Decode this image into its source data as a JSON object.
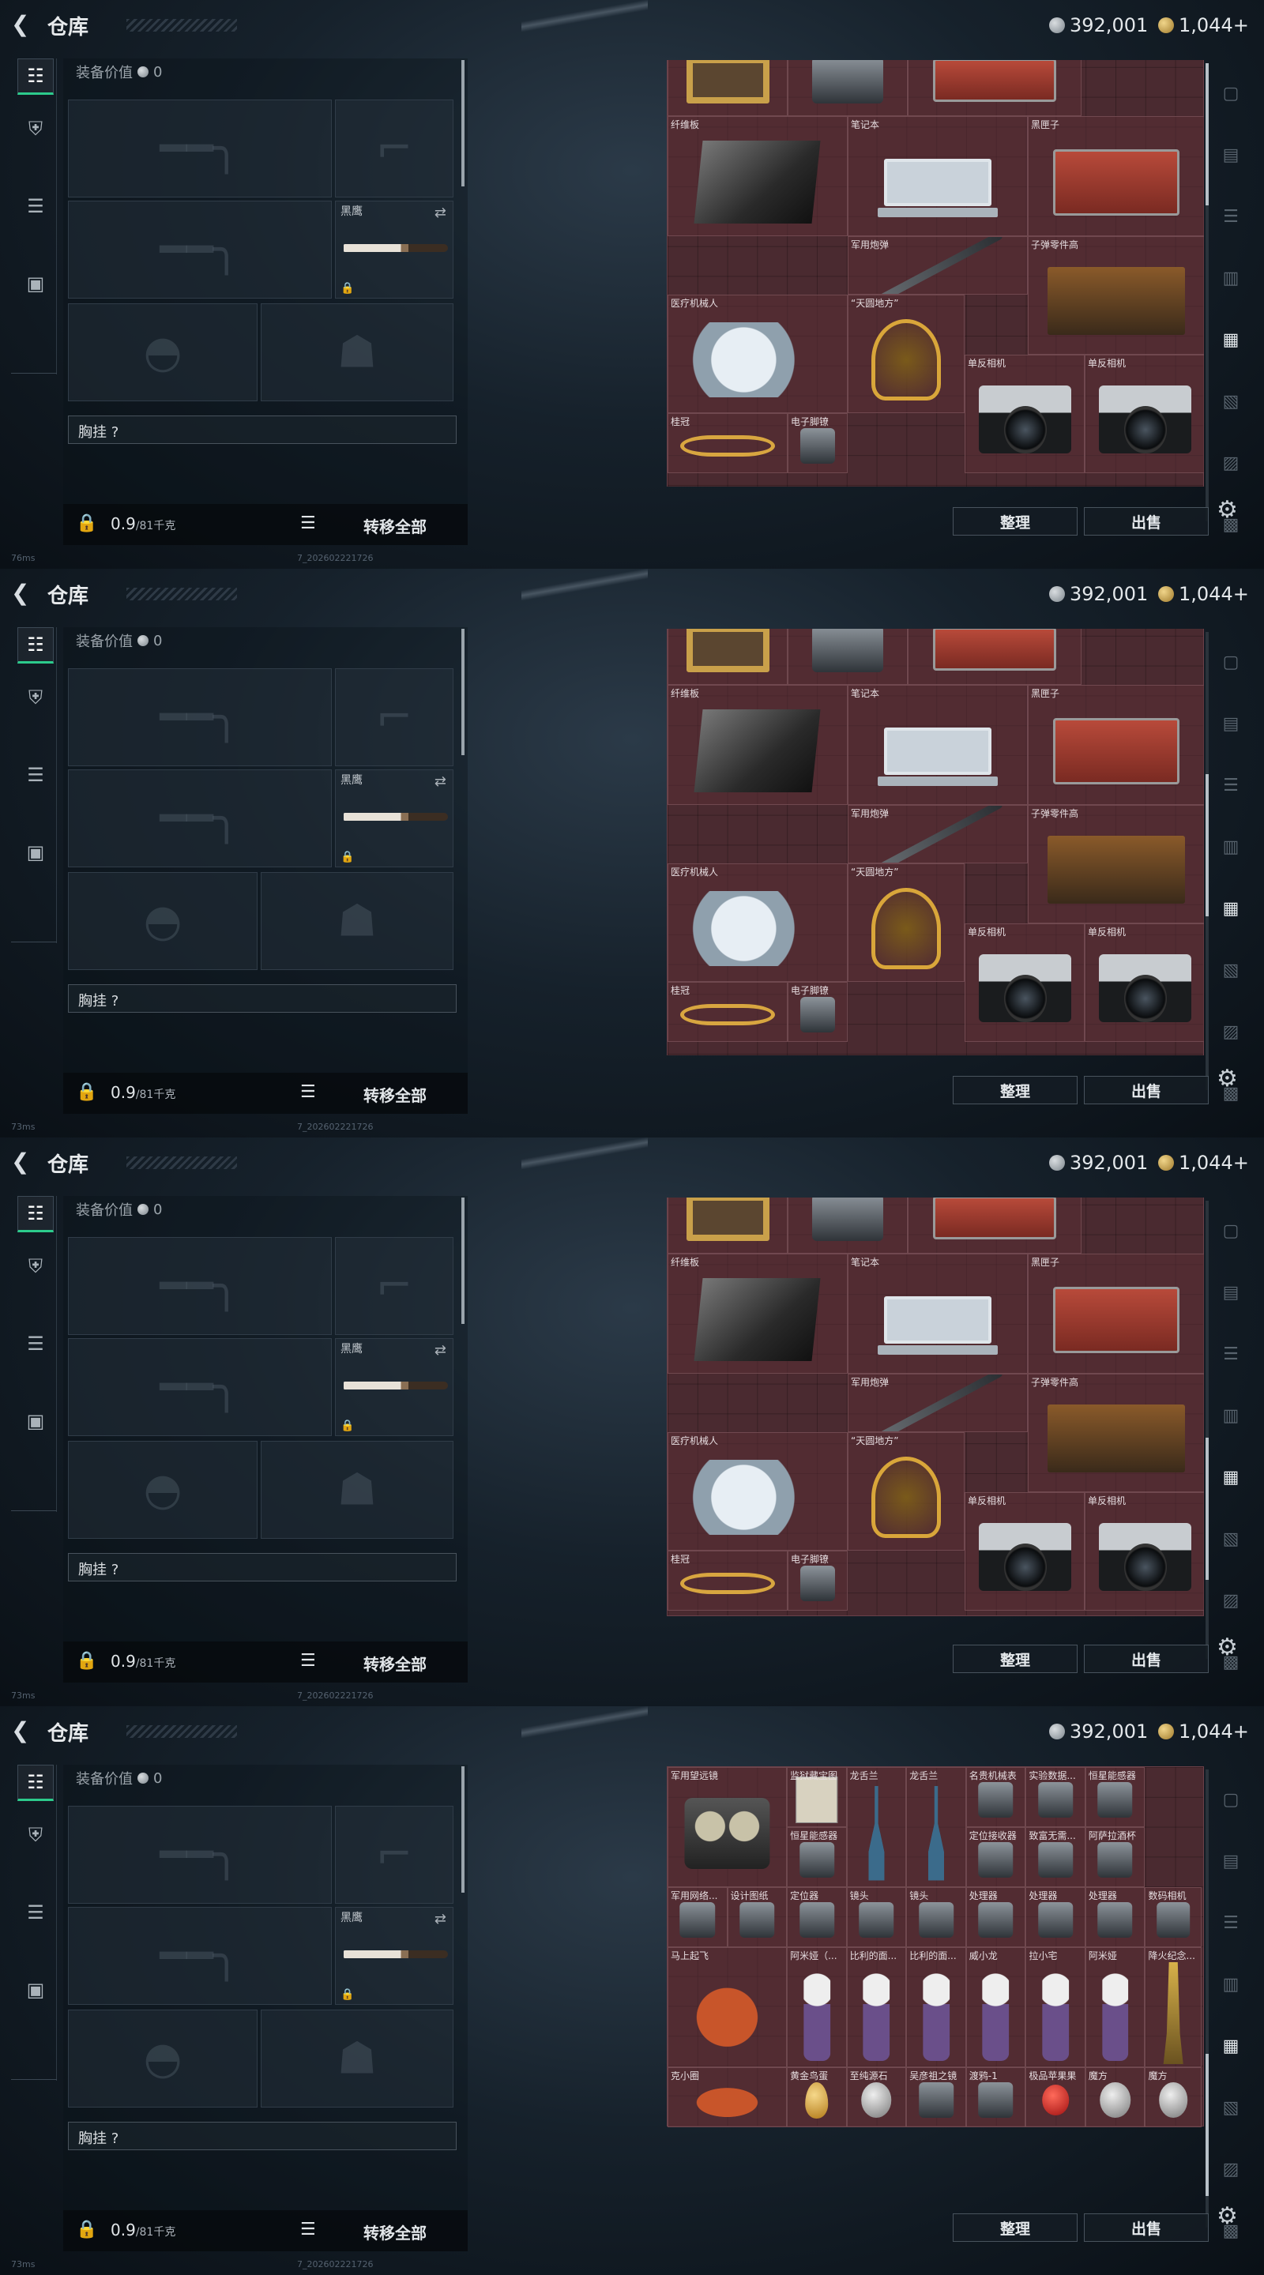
{
  "header": {
    "back_icon": "chevron-left-icon",
    "title": "仓库",
    "silver_amount": "392,001",
    "gold_amount": "1,044+"
  },
  "left_nav": {
    "items": [
      {
        "icon": "pistol-icon",
        "active": true
      },
      {
        "icon": "armor-icon",
        "active": false
      },
      {
        "icon": "clipboard-icon",
        "active": false
      },
      {
        "icon": "briefcase-icon",
        "active": false
      }
    ]
  },
  "equipment": {
    "value_label": "装备价值",
    "value_amount": "0",
    "knife_name": "黑鹰",
    "chest_rig_label": "胸挂 ?",
    "weight_value": "0.9",
    "weight_capacity": "/81千克",
    "transfer_all": "转移全部"
  },
  "actions": {
    "sort": "整理",
    "sell": "出售"
  },
  "frames": [
    {
      "ping": "76ms",
      "build": "7_202602221726",
      "scroll_top": 0.0
    },
    {
      "ping": "73ms",
      "build": "7_202602221726",
      "scroll_top": 0.45
    },
    {
      "ping": "73ms",
      "build": "7_202602221726",
      "scroll_top": 0.75
    },
    {
      "ping": "73ms",
      "build": "7_202602221726",
      "scroll_top": 0.9
    }
  ],
  "stash_view_a": {
    "items": [
      {
        "label": "",
        "icon": "painting-icon"
      },
      {
        "label": "",
        "icon": "device-icon"
      },
      {
        "label": "",
        "icon": "machine-icon"
      },
      {
        "label": "纤维板",
        "icon": "fiberboard-icon"
      },
      {
        "label": "笔记本",
        "icon": "laptop-icon"
      },
      {
        "label": "黑匣子",
        "icon": "black-box-icon"
      },
      {
        "label": "军用炮弹",
        "icon": "missile-icon"
      },
      {
        "label": "子弹零件高",
        "icon": "bullet-parts-icon"
      },
      {
        "label": "医疗机械人",
        "icon": "medical-robot-icon"
      },
      {
        "label": "“天圆地方”",
        "icon": "armillary-icon"
      },
      {
        "label": "单反相机",
        "icon": "camera-icon"
      },
      {
        "label": "单反相机",
        "icon": "camera-icon"
      },
      {
        "label": "桂冠",
        "icon": "laurel-crown-icon"
      },
      {
        "label": "电子脚镣",
        "icon": "ankle-monitor-icon"
      }
    ]
  },
  "stash_view_b": {
    "items": [
      {
        "label": "军用望远镜",
        "icon": "binoculars-icon"
      },
      {
        "label": "监狱藏宝图",
        "icon": "map-icon"
      },
      {
        "label": "龙舌兰",
        "icon": "bottle-icon"
      },
      {
        "label": "龙舌兰",
        "icon": "bottle-icon"
      },
      {
        "label": "名贵机械表",
        "icon": "watch-icon"
      },
      {
        "label": "实验数据...",
        "icon": "data-icon"
      },
      {
        "label": "恒星能感器",
        "icon": "sensor-icon"
      },
      {
        "label": "恒星能感器",
        "icon": "sensor-icon"
      },
      {
        "label": "定位接收器",
        "icon": "receiver-icon"
      },
      {
        "label": "致富无需...",
        "icon": "gear-item-icon"
      },
      {
        "label": "阿萨拉酒杯",
        "icon": "cup-icon"
      },
      {
        "label": "军用网络...",
        "icon": "network-icon"
      },
      {
        "label": "设计图纸",
        "icon": "blueprint-icon"
      },
      {
        "label": "定位器",
        "icon": "locator-icon"
      },
      {
        "label": "镜头",
        "icon": "lens-icon"
      },
      {
        "label": "镜头",
        "icon": "lens-icon"
      },
      {
        "label": "处理器",
        "icon": "cpu-icon"
      },
      {
        "label": "处理器",
        "icon": "cpu-icon"
      },
      {
        "label": "处理器",
        "icon": "cpu-icon"
      },
      {
        "label": "数码相机",
        "icon": "digital-camera-icon"
      },
      {
        "label": "降火纪念...",
        "icon": "souvenir-icon"
      },
      {
        "label": "马上起飞",
        "icon": "horse-statue-icon"
      },
      {
        "label": "阿米娅（...",
        "icon": "doll-icon"
      },
      {
        "label": "比利的面...",
        "icon": "doll-icon"
      },
      {
        "label": "比利的面...",
        "icon": "doll-icon"
      },
      {
        "label": "威小龙",
        "icon": "doll-icon"
      },
      {
        "label": "拉小宅",
        "icon": "doll-icon"
      },
      {
        "label": "阿米娅",
        "icon": "doll-icon"
      },
      {
        "label": "克小圈",
        "icon": "plush-icon"
      },
      {
        "label": "黄金鸟蛋",
        "icon": "golden-egg-icon"
      },
      {
        "label": "至纯源石",
        "icon": "stone-icon"
      },
      {
        "label": "吴彦祖之镜",
        "icon": "mirror-icon"
      },
      {
        "label": "渡鸦-1",
        "icon": "drone-icon"
      },
      {
        "label": "极品苹果果",
        "icon": "apple-icon"
      },
      {
        "label": "魔方",
        "icon": "cube-icon"
      },
      {
        "label": "魔方",
        "icon": "cube-icon"
      }
    ]
  }
}
